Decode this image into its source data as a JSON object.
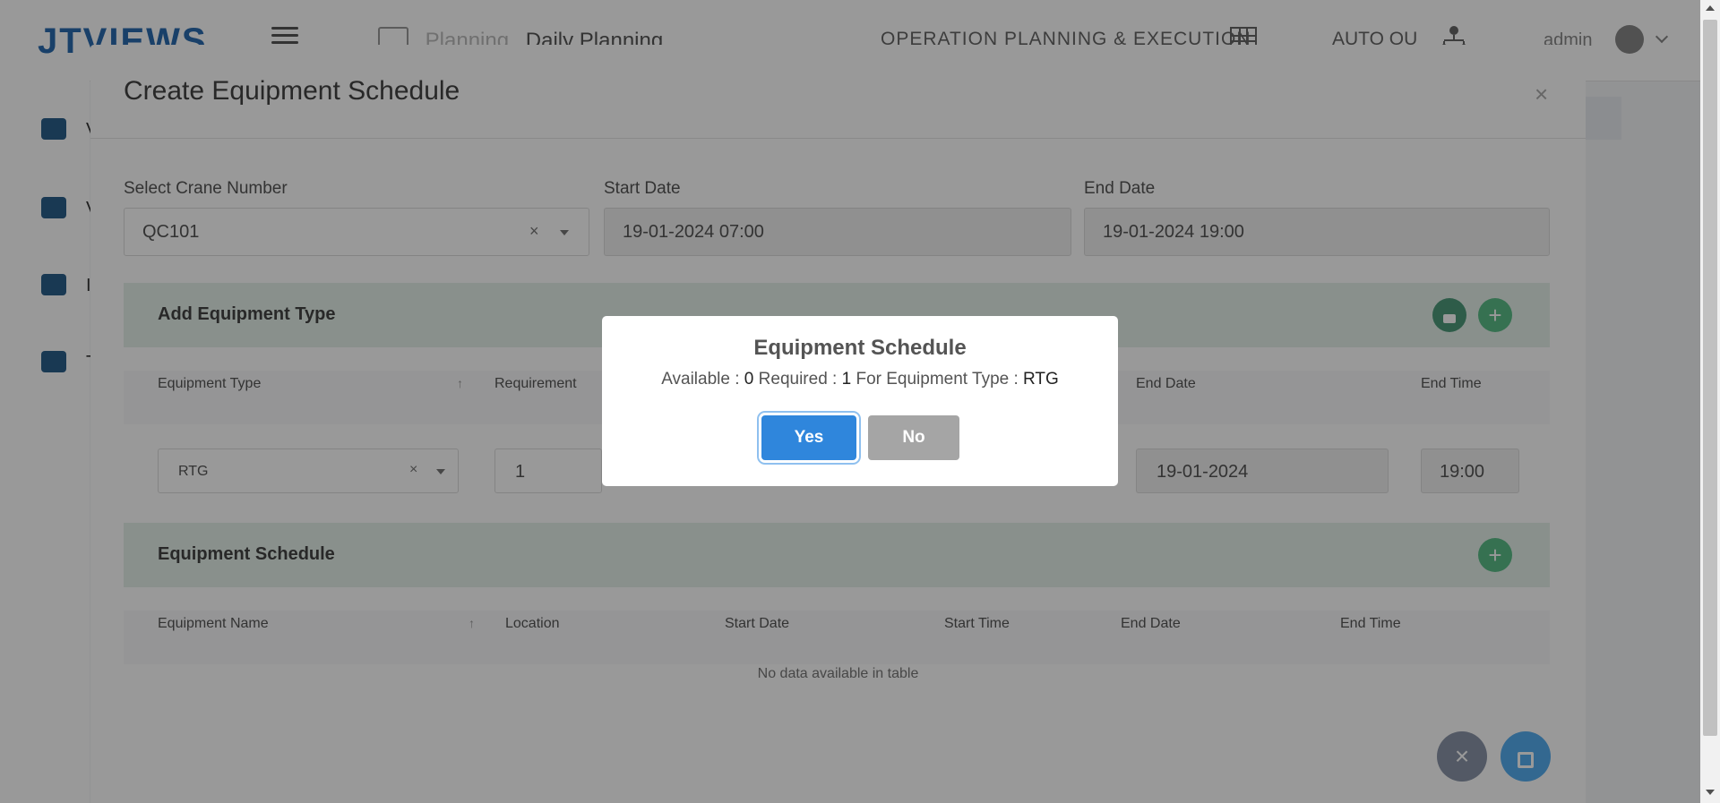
{
  "navbar": {
    "logo_text": "JTVIEWS",
    "breadcrumb_muted": "Planning",
    "breadcrumb_current": "Daily Planning",
    "module": "OPERATION PLANNING & EXECUTION",
    "user_mode": "AUTO OU",
    "user": "admin"
  },
  "sidebar": {
    "items": [
      {
        "icon": "ship-icon",
        "label": "V"
      },
      {
        "icon": "gears-icon",
        "label": "V"
      },
      {
        "icon": "hammer-icon",
        "label": "I"
      },
      {
        "icon": "cubes-icon",
        "label": "T"
      }
    ]
  },
  "modal": {
    "title": "Create Equipment Schedule",
    "close": "×",
    "crane_label": "Select Crane Number",
    "crane_value": "QC101",
    "clear": "×",
    "start_label": "Start Date",
    "start_value": "19-01-2024 07:00",
    "end_label": "End Date",
    "end_value": "19-01-2024 19:00",
    "add_section": {
      "title": "Add Equipment Type",
      "add_btn": "+",
      "columns": [
        "Equipment Type",
        "Requirement",
        "End Date",
        "End Time"
      ],
      "row": {
        "type": "RTG",
        "requirement": "1",
        "end_date": "19-01-2024",
        "end_time": "19:00"
      }
    },
    "schedule_section": {
      "title": "Equipment Schedule",
      "add_btn": "+",
      "columns": [
        "Equipment Name",
        "Location",
        "Start Date",
        "Start Time",
        "End Date",
        "End Time"
      ],
      "empty": "No data available in table"
    },
    "cancel_fab": "×"
  },
  "confirm": {
    "title": "Equipment Schedule",
    "available_label": "Available : ",
    "available": "0",
    "required_label": " Required : ",
    "required": "1",
    "type_label": " For Equipment Type : ",
    "type": "RTG",
    "yes": "Yes",
    "no": "No",
    "yes_color": "#2f86dc",
    "no_color": "#a5a5a5"
  }
}
